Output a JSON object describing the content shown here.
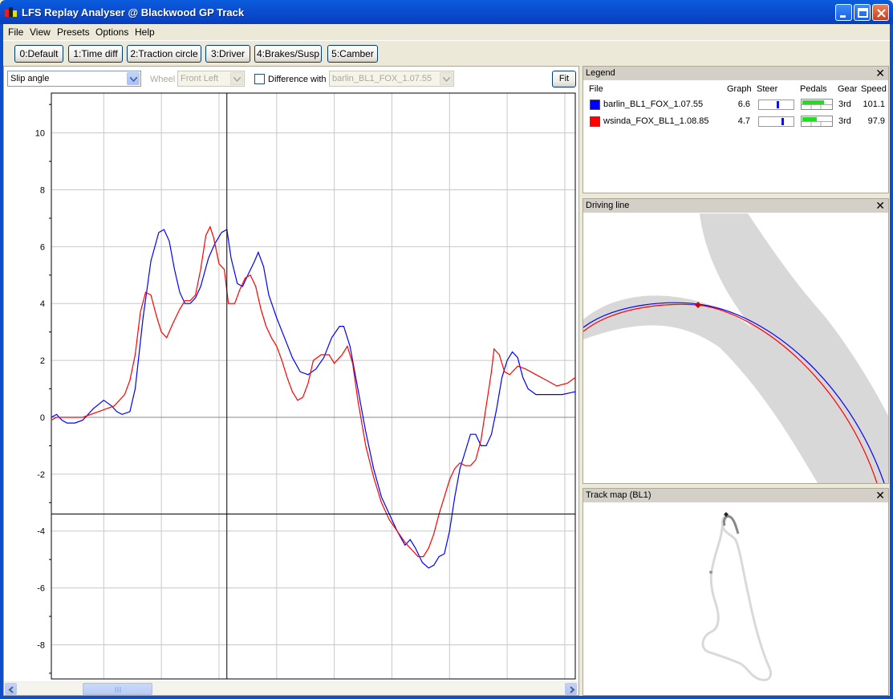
{
  "window": {
    "title": "LFS Replay Analyser @ Blackwood GP Track"
  },
  "menu": [
    "File",
    "View",
    "Presets",
    "Options",
    "Help"
  ],
  "toolbar": {
    "presets": [
      "0:Default",
      "1:Time diff",
      "2:Traction circle",
      "3:Driver",
      "4:Brakes/Susp",
      "5:Camber"
    ]
  },
  "controls": {
    "channel": "Slip angle",
    "wheel_label": "Wheel",
    "wheel_value": "Front Left",
    "difference_label": "Difference with",
    "difference_checked": false,
    "difference_file": "barlin_BL1_FOX_1.07.55",
    "fit_label": "Fit"
  },
  "chart_data": {
    "type": "line",
    "ylim": [
      -9.2,
      11.4
    ],
    "yticks": [
      -8,
      -6,
      -4,
      -2,
      0,
      2,
      4,
      6,
      8,
      10
    ],
    "cursor_y": -3.4,
    "series": [
      {
        "name": "barlin_BL1_FOX_1.07.55",
        "color": "#0000ff",
        "points": [
          [
            0.0,
            0.0
          ],
          [
            0.01,
            0.1
          ],
          [
            0.02,
            -0.1
          ],
          [
            0.03,
            -0.2
          ],
          [
            0.045,
            -0.2
          ],
          [
            0.06,
            -0.1
          ],
          [
            0.08,
            0.3
          ],
          [
            0.1,
            0.6
          ],
          [
            0.115,
            0.4
          ],
          [
            0.125,
            0.2
          ],
          [
            0.135,
            0.1
          ],
          [
            0.15,
            0.2
          ],
          [
            0.16,
            1.0
          ],
          [
            0.175,
            3.5
          ],
          [
            0.19,
            5.5
          ],
          [
            0.205,
            6.5
          ],
          [
            0.215,
            6.6
          ],
          [
            0.225,
            6.2
          ],
          [
            0.235,
            5.2
          ],
          [
            0.245,
            4.4
          ],
          [
            0.255,
            4.0
          ],
          [
            0.265,
            4.0
          ],
          [
            0.275,
            4.2
          ],
          [
            0.285,
            4.6
          ],
          [
            0.3,
            5.6
          ],
          [
            0.312,
            6.1
          ],
          [
            0.325,
            6.5
          ],
          [
            0.335,
            6.6
          ],
          [
            0.343,
            5.6
          ],
          [
            0.355,
            4.7
          ],
          [
            0.365,
            4.6
          ],
          [
            0.375,
            5.0
          ],
          [
            0.388,
            5.5
          ],
          [
            0.395,
            5.8
          ],
          [
            0.405,
            5.3
          ],
          [
            0.415,
            4.3
          ],
          [
            0.43,
            3.5
          ],
          [
            0.445,
            2.8
          ],
          [
            0.46,
            2.1
          ],
          [
            0.475,
            1.6
          ],
          [
            0.49,
            1.5
          ],
          [
            0.505,
            1.7
          ],
          [
            0.52,
            2.1
          ],
          [
            0.535,
            2.8
          ],
          [
            0.55,
            3.2
          ],
          [
            0.558,
            3.2
          ],
          [
            0.57,
            2.5
          ],
          [
            0.585,
            1.0
          ],
          [
            0.6,
            -0.5
          ],
          [
            0.615,
            -1.8
          ],
          [
            0.63,
            -2.8
          ],
          [
            0.645,
            -3.4
          ],
          [
            0.66,
            -4.0
          ],
          [
            0.675,
            -4.5
          ],
          [
            0.685,
            -4.3
          ],
          [
            0.695,
            -4.6
          ],
          [
            0.708,
            -5.1
          ],
          [
            0.72,
            -5.3
          ],
          [
            0.73,
            -5.2
          ],
          [
            0.74,
            -4.9
          ],
          [
            0.75,
            -4.8
          ],
          [
            0.76,
            -4.0
          ],
          [
            0.77,
            -2.8
          ],
          [
            0.78,
            -1.8
          ],
          [
            0.79,
            -1.2
          ],
          [
            0.8,
            -0.6
          ],
          [
            0.81,
            -0.6
          ],
          [
            0.82,
            -1.0
          ],
          [
            0.83,
            -1.0
          ],
          [
            0.84,
            -0.6
          ],
          [
            0.85,
            0.3
          ],
          [
            0.86,
            1.4
          ],
          [
            0.87,
            2.0
          ],
          [
            0.88,
            2.3
          ],
          [
            0.89,
            2.1
          ],
          [
            0.9,
            1.4
          ],
          [
            0.91,
            1.0
          ],
          [
            0.925,
            0.8
          ],
          [
            0.95,
            0.8
          ],
          [
            0.975,
            0.8
          ],
          [
            1.0,
            0.9
          ],
          [
            1.02,
            0.8
          ]
        ]
      },
      {
        "name": "wsinda_FOX_BL1_1.08.85",
        "color": "#ff0000",
        "points": [
          [
            0.0,
            -0.1
          ],
          [
            0.01,
            0.0
          ],
          [
            0.03,
            0.0
          ],
          [
            0.06,
            0.0
          ],
          [
            0.09,
            0.2
          ],
          [
            0.12,
            0.4
          ],
          [
            0.14,
            0.8
          ],
          [
            0.15,
            1.3
          ],
          [
            0.16,
            2.2
          ],
          [
            0.17,
            3.7
          ],
          [
            0.18,
            4.4
          ],
          [
            0.19,
            4.3
          ],
          [
            0.2,
            3.6
          ],
          [
            0.21,
            3.0
          ],
          [
            0.22,
            2.8
          ],
          [
            0.232,
            3.3
          ],
          [
            0.245,
            3.8
          ],
          [
            0.255,
            4.1
          ],
          [
            0.265,
            4.1
          ],
          [
            0.275,
            4.3
          ],
          [
            0.285,
            5.2
          ],
          [
            0.295,
            6.4
          ],
          [
            0.303,
            6.7
          ],
          [
            0.31,
            6.3
          ],
          [
            0.32,
            5.4
          ],
          [
            0.33,
            5.2
          ],
          [
            0.338,
            4.0
          ],
          [
            0.35,
            4.0
          ],
          [
            0.36,
            4.5
          ],
          [
            0.37,
            4.9
          ],
          [
            0.38,
            5.0
          ],
          [
            0.39,
            4.6
          ],
          [
            0.4,
            3.8
          ],
          [
            0.41,
            3.2
          ],
          [
            0.42,
            2.8
          ],
          [
            0.43,
            2.5
          ],
          [
            0.44,
            2.0
          ],
          [
            0.45,
            1.4
          ],
          [
            0.46,
            0.9
          ],
          [
            0.47,
            0.6
          ],
          [
            0.48,
            0.7
          ],
          [
            0.49,
            1.2
          ],
          [
            0.5,
            2.0
          ],
          [
            0.515,
            2.2
          ],
          [
            0.53,
            2.2
          ],
          [
            0.54,
            1.9
          ],
          [
            0.555,
            2.2
          ],
          [
            0.565,
            2.5
          ],
          [
            0.575,
            1.9
          ],
          [
            0.585,
            0.6
          ],
          [
            0.6,
            -1.0
          ],
          [
            0.615,
            -2.1
          ],
          [
            0.63,
            -3.0
          ],
          [
            0.645,
            -3.6
          ],
          [
            0.66,
            -4.0
          ],
          [
            0.675,
            -4.4
          ],
          [
            0.69,
            -4.7
          ],
          [
            0.7,
            -4.9
          ],
          [
            0.71,
            -4.9
          ],
          [
            0.72,
            -4.6
          ],
          [
            0.73,
            -4.1
          ],
          [
            0.74,
            -3.4
          ],
          [
            0.75,
            -2.8
          ],
          [
            0.76,
            -2.2
          ],
          [
            0.77,
            -1.8
          ],
          [
            0.78,
            -1.6
          ],
          [
            0.79,
            -1.7
          ],
          [
            0.8,
            -1.7
          ],
          [
            0.81,
            -1.5
          ],
          [
            0.82,
            -0.8
          ],
          [
            0.83,
            0.4
          ],
          [
            0.84,
            1.6
          ],
          [
            0.845,
            2.4
          ],
          [
            0.855,
            2.2
          ],
          [
            0.865,
            1.6
          ],
          [
            0.875,
            1.5
          ],
          [
            0.89,
            1.8
          ],
          [
            0.905,
            1.7
          ],
          [
            0.925,
            1.5
          ],
          [
            0.945,
            1.3
          ],
          [
            0.965,
            1.1
          ],
          [
            0.985,
            1.2
          ],
          [
            1.005,
            1.4
          ],
          [
            1.02,
            1.4
          ]
        ]
      }
    ]
  },
  "legend_panel": {
    "title": "Legend",
    "columns": {
      "file": "File",
      "graph": "Graph",
      "steer": "Steer",
      "pedals": "Pedals",
      "gear": "Gear",
      "speed": "Speed"
    },
    "rows": [
      {
        "file": "barlin_BL1_FOX_1.07.55",
        "color": "#0000ff",
        "graph": "6.6",
        "steer": 0.55,
        "throttle": 0.75,
        "brake": 0.0,
        "gear": "3rd",
        "speed": "101.1"
      },
      {
        "file": "wsinda_FOX_BL1_1.08.85",
        "color": "#ff0000",
        "graph": "4.7",
        "steer": 0.7,
        "throttle": 0.5,
        "brake": 0.0,
        "gear": "3rd",
        "speed": "97.9"
      }
    ]
  },
  "driving_line_panel": {
    "title": "Driving line"
  },
  "track_map_panel": {
    "title": "Track map (BL1)"
  }
}
